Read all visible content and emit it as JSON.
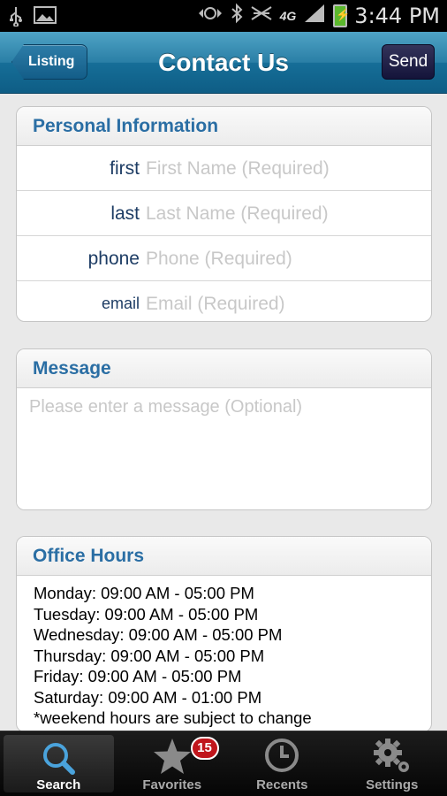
{
  "status_bar": {
    "time": "3:44 PM",
    "network": "4G",
    "icons": [
      "usb-icon",
      "image-icon",
      "data-sync-icon",
      "bluetooth-icon",
      "mute-icon",
      "signal-icon",
      "battery-charging-icon"
    ]
  },
  "nav": {
    "back_label": "Listing",
    "title": "Contact Us",
    "send_label": "Send"
  },
  "personal": {
    "header": "Personal Information",
    "fields": [
      {
        "label": "first",
        "placeholder": "First Name (Required)"
      },
      {
        "label": "last",
        "placeholder": "Last Name (Required)"
      },
      {
        "label": "phone",
        "placeholder": "Phone (Required)"
      },
      {
        "label": "email",
        "placeholder": "Email (Required)"
      }
    ]
  },
  "message": {
    "header": "Message",
    "placeholder": "Please enter a message (Optional)"
  },
  "hours": {
    "header": "Office Hours",
    "lines": [
      "Monday: 09:00 AM - 05:00 PM",
      "Tuesday: 09:00 AM - 05:00 PM",
      "Wednesday: 09:00 AM - 05:00 PM",
      "Thursday: 09:00 AM - 05:00 PM",
      "Friday: 09:00 AM - 05:00 PM",
      "Saturday: 09:00 AM - 01:00 PM",
      "*weekend hours are subject to change"
    ]
  },
  "tabs": [
    {
      "label": "Search",
      "icon": "search-icon",
      "active": true
    },
    {
      "label": "Favorites",
      "icon": "star-icon",
      "badge": "15"
    },
    {
      "label": "Recents",
      "icon": "clock-icon"
    },
    {
      "label": "Settings",
      "icon": "gear-icon"
    }
  ],
  "colors": {
    "nav_blue": "#166e98",
    "header_text": "#2a6ea4",
    "badge_red": "#c0161c"
  }
}
